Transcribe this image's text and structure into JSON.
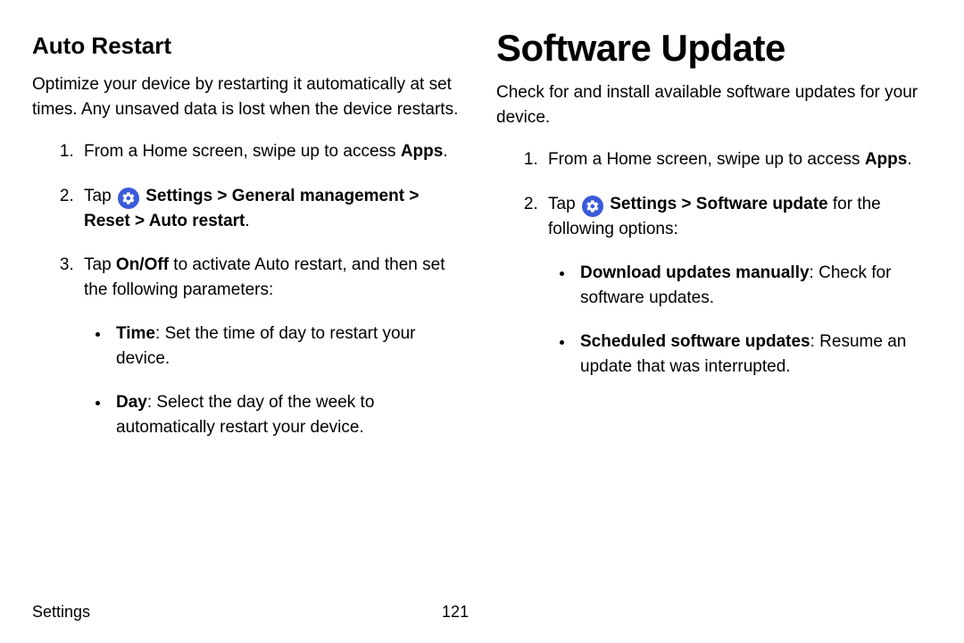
{
  "left": {
    "heading": "Auto Restart",
    "intro": "Optimize your device by restarting it automatically at set times. Any unsaved data is lost when the device restarts.",
    "step1_prefix": "From a Home screen, swipe up to access ",
    "step1_bold": "Apps",
    "step1_suffix": ".",
    "step2_tap": "Tap ",
    "step2_path_bold": "Settings > General management > Reset > Auto restart",
    "step2_suffix": ".",
    "step3_tap": "Tap ",
    "step3_bold": "On/Off",
    "step3_rest": " to activate Auto restart, and then set the following parameters:",
    "bullet1_bold": "Time",
    "bullet1_rest": ": Set the time of day to restart your device.",
    "bullet2_bold": "Day",
    "bullet2_rest": ": Select the day of the week to automatically restart your device."
  },
  "right": {
    "chapter": "Software Update",
    "intro": "Check for and install available software updates for your device.",
    "step1_prefix": "From a Home screen, swipe up to access ",
    "step1_bold": "Apps",
    "step1_suffix": ".",
    "step2_tap": "Tap ",
    "step2_path_bold": "Settings > Software update",
    "step2_rest": " for the following options:",
    "bullet1_bold": "Download updates manually",
    "bullet1_rest": ": Check for software updates.",
    "bullet2_bold": "Scheduled software updates",
    "bullet2_rest": ": Resume an update that was interrupted."
  },
  "footer": {
    "section": "Settings",
    "page": "121"
  }
}
